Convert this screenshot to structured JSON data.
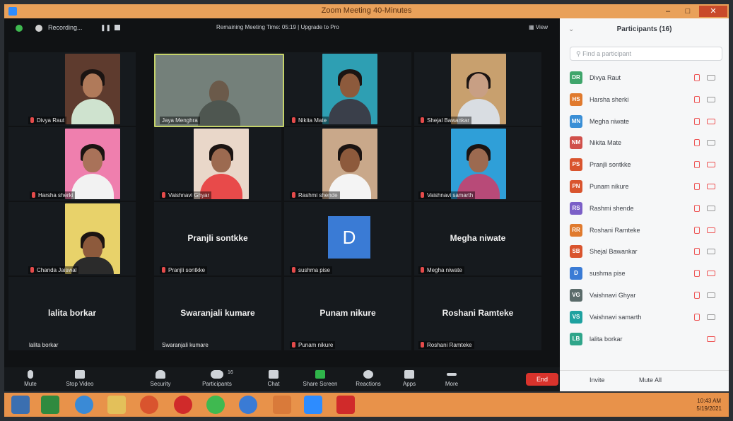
{
  "window": {
    "title": "Zoom Meeting 40-Minutes",
    "min": "–",
    "max": "□",
    "close": "✕"
  },
  "topbar": {
    "recording_label": "Recording...",
    "pause_label": "❚❚",
    "banner": "Remaining Meeting Time: 05:19 | Upgrade to Pro",
    "view_label": "▦ View"
  },
  "tiles": [
    {
      "name": "Divya Raut",
      "big": "",
      "video": true,
      "muted": true
    },
    {
      "name": "Jaya Menghra",
      "big": "",
      "video": true,
      "muted": false,
      "wide": true
    },
    {
      "name": "Nikita Mate",
      "big": "",
      "video": true,
      "muted": true
    },
    {
      "name": "Shejal Bawankar",
      "big": "",
      "video": true,
      "muted": true
    },
    {
      "name": "Harsha sherki",
      "big": "",
      "video": true,
      "muted": true
    },
    {
      "name": "Vaishnavi Ghyar",
      "big": "",
      "video": true,
      "muted": true
    },
    {
      "name": "Rashmi shende",
      "big": "",
      "video": true,
      "muted": true
    },
    {
      "name": "Vaishnavi samarth",
      "big": "",
      "video": true,
      "muted": true
    },
    {
      "name": "Chanda Jaiswal",
      "big": "",
      "video": true,
      "muted": true
    },
    {
      "name": "Pranjli sontkke",
      "big": "Pranjli sontkke",
      "video": false,
      "muted": true
    },
    {
      "name": "sushma pise",
      "big": "",
      "video": false,
      "muted": true,
      "avatar": "D"
    },
    {
      "name": "Megha niwate",
      "big": "Megha niwate",
      "video": false,
      "muted": true
    },
    {
      "name": "lalita borkar",
      "big": "lalita borkar",
      "video": false,
      "muted": false
    },
    {
      "name": "Swaranjali kumare",
      "big": "Swaranjali kumare",
      "video": false,
      "muted": false
    },
    {
      "name": "Punam nikure",
      "big": "Punam nikure",
      "video": false,
      "muted": true
    },
    {
      "name": "Roshani Ramteke",
      "big": "Roshani Ramteke",
      "video": false,
      "muted": true
    }
  ],
  "toolbar": {
    "mute": "Mute",
    "stop_video": "Stop Video",
    "security": "Security",
    "participants": "Participants",
    "participants_count": "16",
    "chat": "Chat",
    "share_screen": "Share Screen",
    "reactions": "Reactions",
    "apps": "Apps",
    "more": "More",
    "end": "End"
  },
  "panel": {
    "title": "Participants (16)",
    "search_placeholder": "Find a participant",
    "invite": "Invite",
    "mute_all": "Mute All",
    "participants": [
      {
        "initials": "DR",
        "name": "Divya Raut",
        "color": "#3fa56b"
      },
      {
        "initials": "HS",
        "name": "Harsha sherki",
        "color": "#e07a2e"
      },
      {
        "initials": "MN",
        "name": "Megha niwate",
        "color": "#3a8fd6"
      },
      {
        "initials": "NM",
        "name": "Nikita Mate",
        "color": "#d0504b"
      },
      {
        "initials": "PS",
        "name": "Pranjli sontkke",
        "color": "#d9542e"
      },
      {
        "initials": "PN",
        "name": "Punam nikure",
        "color": "#d9542e"
      },
      {
        "initials": "RS",
        "name": "Rashmi shende",
        "color": "#7b5fc7"
      },
      {
        "initials": "RR",
        "name": "Roshani Ramteke",
        "color": "#e07a2e"
      },
      {
        "initials": "SB",
        "name": "Shejal Bawankar",
        "color": "#d9542e"
      },
      {
        "initials": "D",
        "name": "sushma pise",
        "color": "#3a7bd5"
      },
      {
        "initials": "VG",
        "name": "Vaishnavi Ghyar",
        "color": "#5a6b6a"
      },
      {
        "initials": "VS",
        "name": "Vaishnavi samarth",
        "color": "#1ea1a0"
      },
      {
        "initials": "LB",
        "name": "lalita borkar",
        "color": "#2fa58a"
      }
    ]
  },
  "taskbar": {
    "time": "10:43 AM",
    "date": "5/19/2021"
  }
}
